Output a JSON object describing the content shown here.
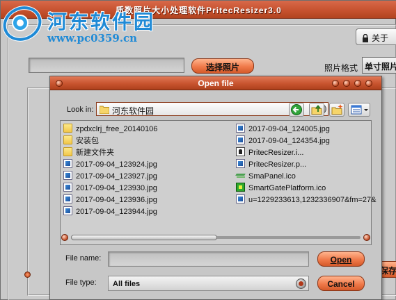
{
  "app": {
    "title": "质数照片大小处理软件PritecResizer3.0",
    "about_label": "关于",
    "choose_photo_label": "选择照片",
    "photo_format_label": "照片格式",
    "photo_format_value": "单寸照片",
    "save_label": "保存"
  },
  "watermark": {
    "title": "河东软件园",
    "url": "www.pc0359.cn"
  },
  "dialog": {
    "title": "Open file",
    "look_in_label": "Look in:",
    "look_in_value": "河东软件园",
    "files_col1": [
      {
        "name": "zpdxclrj_free_20140106",
        "kind": "folder"
      },
      {
        "name": "安装包",
        "kind": "folder"
      },
      {
        "name": "新建文件夹",
        "kind": "folder"
      },
      {
        "name": "2017-09-04_123924.jpg",
        "kind": "jpg"
      },
      {
        "name": "2017-09-04_123927.jpg",
        "kind": "jpg"
      },
      {
        "name": "2017-09-04_123930.jpg",
        "kind": "jpg"
      },
      {
        "name": "2017-09-04_123936.jpg",
        "kind": "jpg"
      },
      {
        "name": "2017-09-04_123944.jpg",
        "kind": "jpg"
      }
    ],
    "files_col2": [
      {
        "name": "2017-09-04_124005.jpg",
        "kind": "jpg"
      },
      {
        "name": "2017-09-04_124354.jpg",
        "kind": "jpg"
      },
      {
        "name": "PritecResizer.i...",
        "kind": "exe"
      },
      {
        "name": "PritecResizer.p...",
        "kind": "jpg"
      },
      {
        "name": "SmaPanel.ico",
        "kind": "sma"
      },
      {
        "name": "SmartGatePlatform.ico",
        "kind": "sgp"
      },
      {
        "name": "u=1229233613,1232336907&fm=27&",
        "kind": "url"
      }
    ],
    "file_name_label": "File name:",
    "file_name_value": "",
    "file_type_label": "File type:",
    "file_type_value": "All files",
    "open_label": "Open",
    "cancel_label": "Cancel"
  },
  "colors": {
    "titlebar": "#c7522f",
    "button_orange": "#f07a4a",
    "watermark_blue": "#1f8ad6"
  }
}
